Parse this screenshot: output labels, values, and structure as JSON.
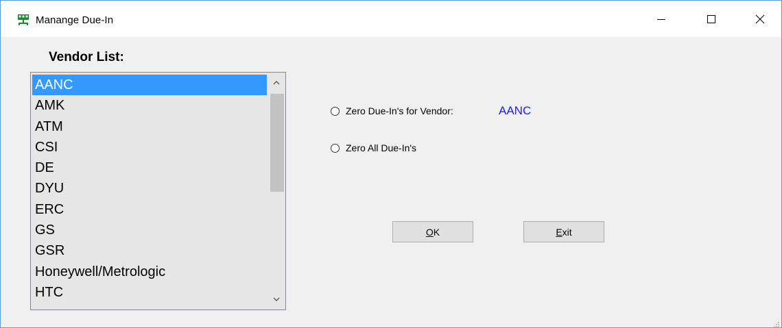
{
  "window": {
    "title": "Manange Due-In",
    "icon": "network-computer-icon",
    "controls": [
      "minimize",
      "maximize",
      "close"
    ]
  },
  "vendor_list": {
    "label": "Vendor List:",
    "items": [
      "AANC",
      "AMK",
      "ATM",
      "CSI",
      "DE",
      "DYU",
      "ERC",
      "GS",
      "GSR",
      "Honeywell/Metrologic",
      "HTC"
    ],
    "selected_index": 0
  },
  "options": {
    "zero_vendor_label": "Zero Due-In's for Vendor:",
    "zero_vendor_value": "AANC",
    "zero_all_label": "Zero All Due-In's"
  },
  "buttons": {
    "ok_mnemonic": "O",
    "ok_rest": "K",
    "exit_mnemonic": "E",
    "exit_rest": "xit"
  },
  "colors": {
    "selection": "#3399ff",
    "vendor_value": "#1a1aff",
    "window_border": "#5a9bd5"
  }
}
